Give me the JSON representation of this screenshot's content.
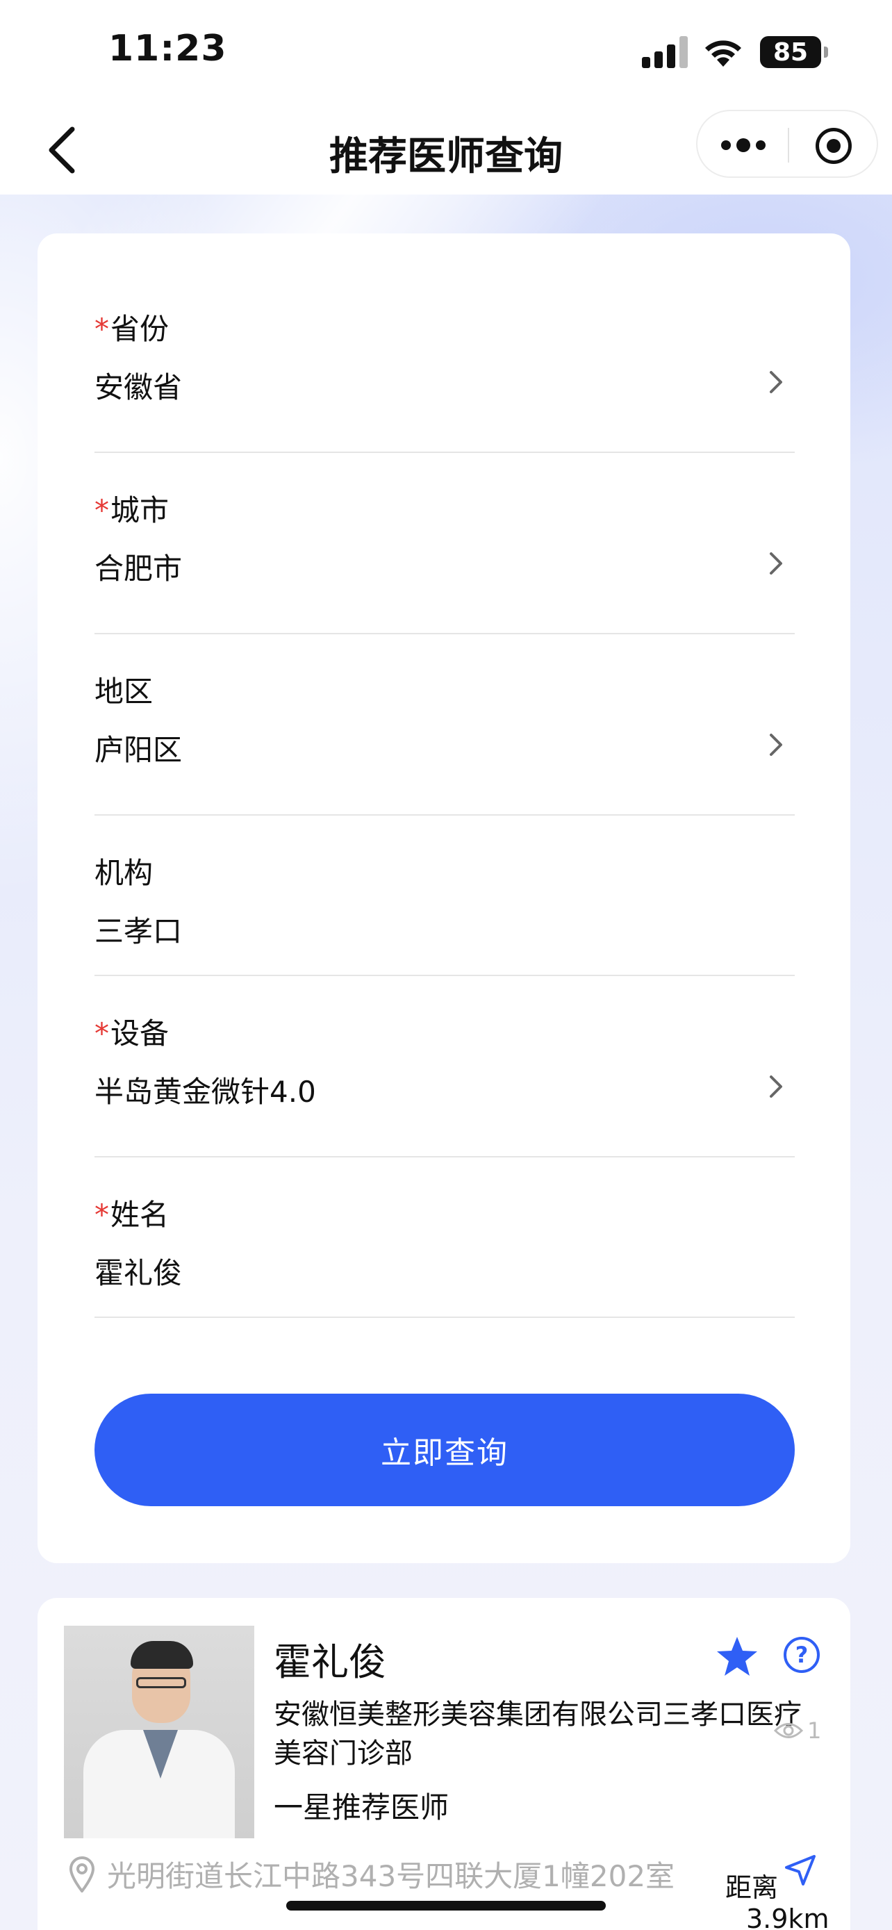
{
  "status_bar": {
    "time": "11:23",
    "battery": "85"
  },
  "nav": {
    "title": "推荐医师查询"
  },
  "form": {
    "fields": [
      {
        "label": "省份",
        "required": true,
        "value": "安徽省",
        "has_chevron": true
      },
      {
        "label": "城市",
        "required": true,
        "value": "合肥市",
        "has_chevron": true
      },
      {
        "label": "地区",
        "required": false,
        "value": "庐阳区",
        "has_chevron": true
      },
      {
        "label": "机构",
        "required": false,
        "value": "三孝口",
        "has_chevron": false
      },
      {
        "label": "设备",
        "required": true,
        "value": "半岛黄金微针4.0",
        "has_chevron": true
      },
      {
        "label": "姓名",
        "required": true,
        "value": "霍礼俊",
        "has_chevron": false
      }
    ],
    "required_mark": "*",
    "submit_label": "立即查询"
  },
  "result": {
    "name": "霍礼俊",
    "organization": "安徽恒美整形美容集团有限公司三孝口医疗美容门诊部",
    "views": "1",
    "level": "一星推荐医师",
    "address": "光明街道长江中路343号四联大厦1幢202室",
    "distance_label": "距离",
    "distance_value": "3.9km",
    "help_symbol": "?"
  },
  "colors": {
    "accent": "#2f5ff5",
    "required": "#e53935",
    "muted": "#b0b0b0"
  },
  "icons": [
    "back-icon",
    "more-icon",
    "target-icon",
    "chevron-right-icon",
    "star-icon",
    "help-icon",
    "eye-icon",
    "location-pin-icon",
    "navigation-arrow-icon"
  ]
}
